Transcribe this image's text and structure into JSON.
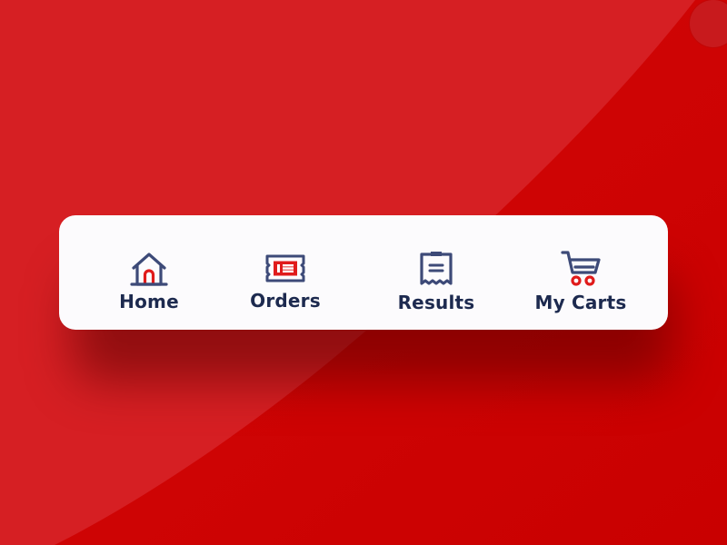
{
  "theme": {
    "background_color": "#d61f23",
    "background_dark_color": "#cc0000",
    "card_color": "#fcfbfd",
    "text_color": "#1d2a4f",
    "icon_stroke_color": "#3d4a78",
    "accent_color": "#e01b1b"
  },
  "nav": {
    "items": [
      {
        "label": "Home",
        "icon": "home-icon"
      },
      {
        "label": "Orders",
        "icon": "ticket-icon"
      },
      {
        "label": "Results",
        "icon": "receipt-icon"
      },
      {
        "label": "My Carts",
        "icon": "cart-icon"
      }
    ]
  }
}
